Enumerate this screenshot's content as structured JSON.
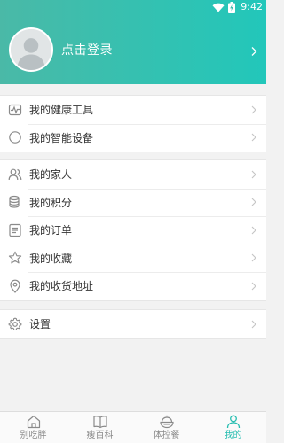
{
  "status_bar": {
    "time": "9:42"
  },
  "profile": {
    "login_label": "点击登录"
  },
  "group1": [
    {
      "label": "我的健康工具",
      "icon": "health-tools-icon"
    },
    {
      "label": "我的智能设备",
      "icon": "smart-device-icon"
    }
  ],
  "group2": [
    {
      "label": "我的家人",
      "icon": "family-icon"
    },
    {
      "label": "我的积分",
      "icon": "points-icon"
    },
    {
      "label": "我的订单",
      "icon": "orders-icon"
    },
    {
      "label": "我的收藏",
      "icon": "star-icon"
    },
    {
      "label": "我的收货地址",
      "icon": "location-icon"
    }
  ],
  "group3": [
    {
      "label": "设置",
      "icon": "gear-icon"
    }
  ],
  "bottom_nav": [
    {
      "label": "别吃胖",
      "icon": "home-icon",
      "active": false
    },
    {
      "label": "瘦百科",
      "icon": "book-icon",
      "active": false
    },
    {
      "label": "体控餐",
      "icon": "meal-bowl-icon",
      "active": false
    },
    {
      "label": "我的",
      "icon": "person-icon",
      "active": true
    }
  ],
  "colors": {
    "header_start": "#4ab9a7",
    "header_end": "#22c7ba",
    "accent": "#26bdb0",
    "background": "#f2f2f2",
    "text": "#333333",
    "icon_gray": "#8a8a8a"
  }
}
